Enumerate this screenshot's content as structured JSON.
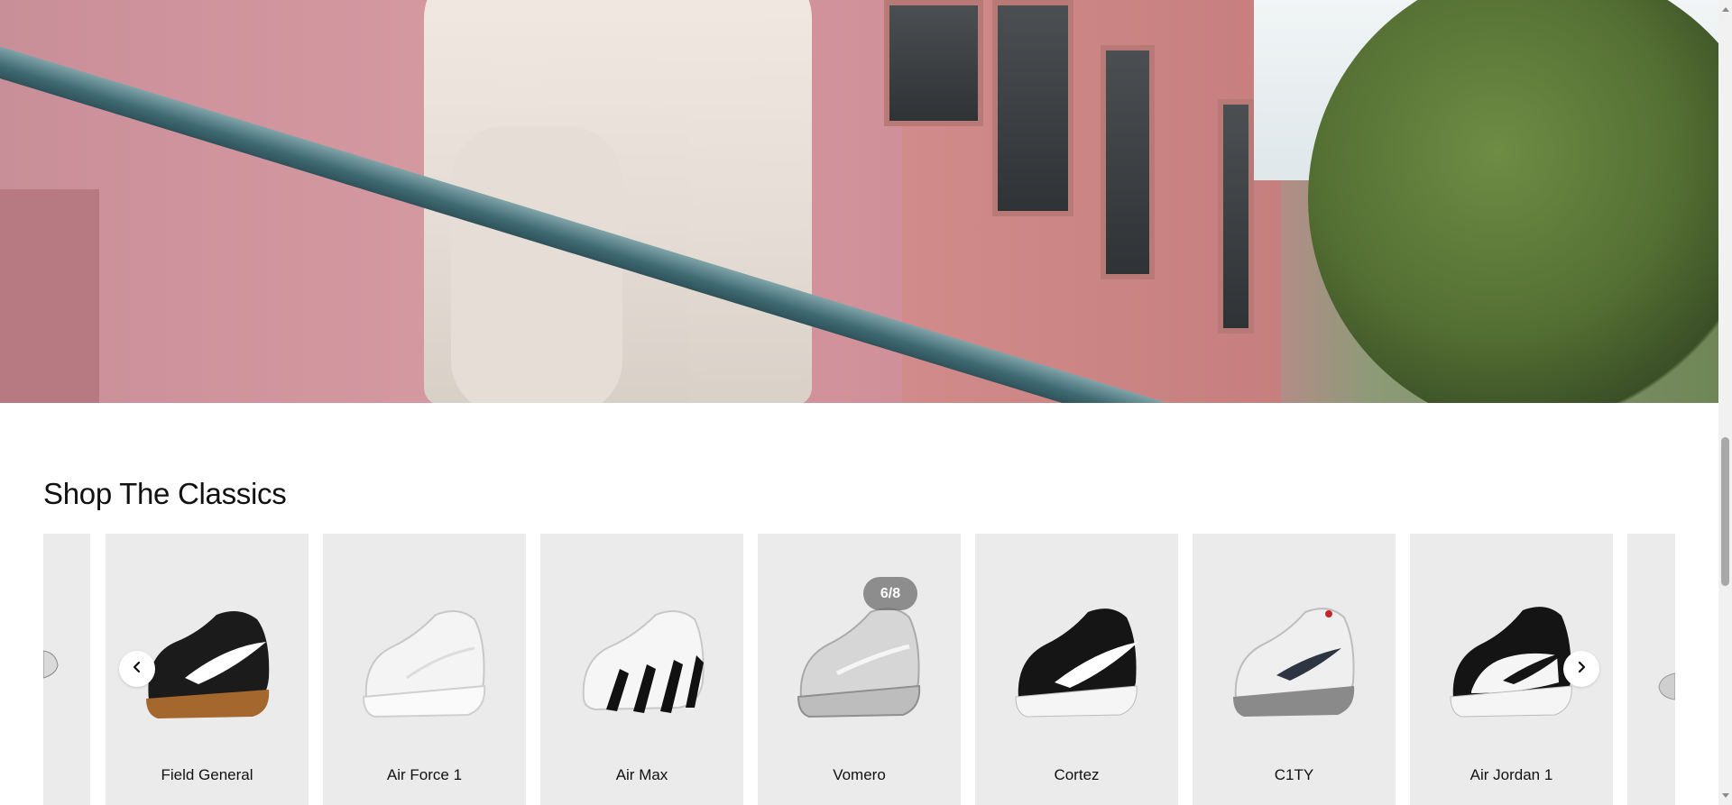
{
  "section": {
    "title": "Shop The Classics"
  },
  "carousel": {
    "counter": "6/8",
    "prev_icon": "chevron-left-icon",
    "next_icon": "chevron-right-icon",
    "items": [
      {
        "label": "Field General",
        "icon": "sneaker-black-gum-icon"
      },
      {
        "label": "Air Force 1",
        "icon": "sneaker-white-icon"
      },
      {
        "label": "Air Max",
        "icon": "sneaker-white-black-stripes-icon"
      },
      {
        "label": "Vomero",
        "icon": "sneaker-grey-runner-icon"
      },
      {
        "label": "Cortez",
        "icon": "sneaker-black-white-swoosh-icon"
      },
      {
        "label": "C1TY",
        "icon": "sneaker-white-grey-icon"
      },
      {
        "label": "Air Jordan 1",
        "icon": "sneaker-panda-high-icon"
      }
    ]
  },
  "colors": {
    "card_bg": "#ebebeb",
    "text": "#111111",
    "counter_bg": "#6e6e6e"
  }
}
